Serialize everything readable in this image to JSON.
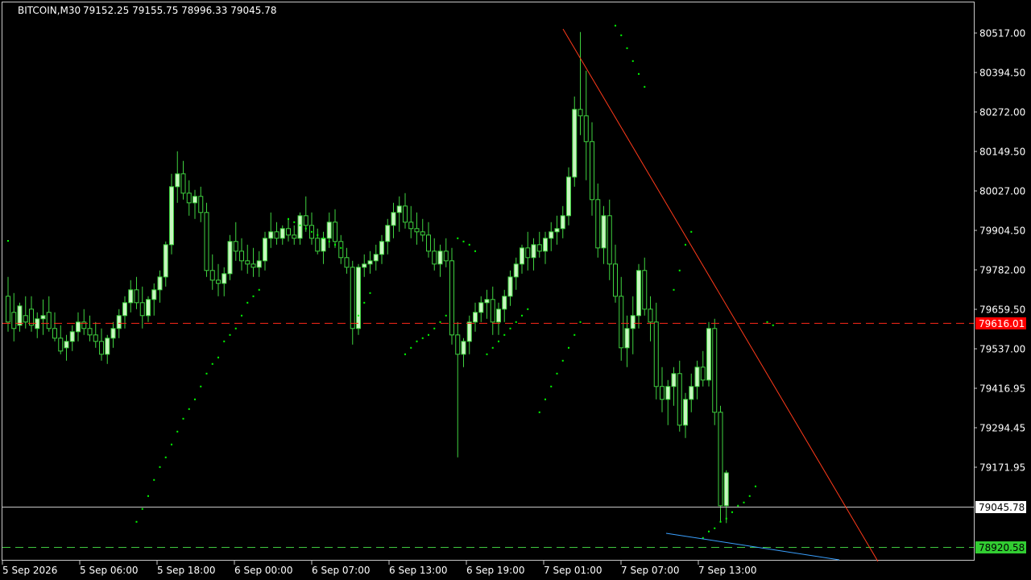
{
  "header": {
    "symbol": "BITCOIN,M30",
    "ohlc": "79152.25 79155.75 78996.33 79045.78"
  },
  "colors": {
    "background": "#000000",
    "frame": "#c8c8c8",
    "bull_candle": "#c8f5c0",
    "bear_candle": "#000000",
    "wick": "#3fd23f",
    "sar_dots": "#00ff00",
    "red_line": "#ff3a1a",
    "blue_line": "#3aa0ff",
    "red_label_bg": "#ff0000",
    "green_label_bg": "#32cd32"
  },
  "chart_data": {
    "type": "candlestick",
    "y_axis_ticks": [
      "80517.00",
      "80394.50",
      "80272.00",
      "80149.50",
      "80027.00",
      "79904.50",
      "79782.00",
      "79659.50",
      "79537.00",
      "79416.95",
      "79294.45",
      "79171.95"
    ],
    "y_range": [
      78880,
      80530
    ],
    "x_axis_ticks": [
      "5 Sep 2026",
      "5 Sep 06:00",
      "5 Sep 18:00",
      "6 Sep 00:00",
      "6 Sep 07:00",
      "6 Sep 13:00",
      "6 Sep 19:00",
      "7 Sep 01:00",
      "7 Sep 07:00",
      "7 Sep 13:00"
    ],
    "price_labels": {
      "current": "79045.78",
      "red_level": "79616.01",
      "green_level": "78920.58"
    },
    "levels": {
      "current": 79045.78,
      "red_level": 79616.01,
      "green_level": 78920.58
    },
    "candles": [
      [
        79700,
        79760,
        79590,
        79620
      ],
      [
        79650,
        79710,
        79560,
        79600
      ],
      [
        79610,
        79680,
        79590,
        79670
      ],
      [
        79640,
        79700,
        79600,
        79620
      ],
      [
        79660,
        79700,
        79590,
        79610
      ],
      [
        79600,
        79650,
        79570,
        79630
      ],
      [
        79630,
        79690,
        79580,
        79640
      ],
      [
        79650,
        79700,
        79590,
        79600
      ],
      [
        79600,
        79650,
        79560,
        79570
      ],
      [
        79570,
        79610,
        79520,
        79530
      ],
      [
        79540,
        79580,
        79500,
        79560
      ],
      [
        79560,
        79610,
        79530,
        79590
      ],
      [
        79590,
        79650,
        79560,
        79620
      ],
      [
        79620,
        79660,
        79580,
        79600
      ],
      [
        79600,
        79640,
        79560,
        79580
      ],
      [
        79580,
        79620,
        79540,
        79560
      ],
      [
        79560,
        79600,
        79500,
        79520
      ],
      [
        79520,
        79580,
        79490,
        79570
      ],
      [
        79570,
        79620,
        79540,
        79600
      ],
      [
        79600,
        79660,
        79570,
        79640
      ],
      [
        79640,
        79700,
        79600,
        79680
      ],
      [
        79680,
        79750,
        79650,
        79720
      ],
      [
        79720,
        79760,
        79660,
        79680
      ],
      [
        79680,
        79730,
        79600,
        79640
      ],
      [
        79640,
        79700,
        79620,
        79690
      ],
      [
        79690,
        79740,
        79640,
        79720
      ],
      [
        79720,
        79780,
        79680,
        79760
      ],
      [
        79760,
        79870,
        79730,
        79860
      ],
      [
        79860,
        80080,
        79830,
        80040
      ],
      [
        80040,
        80150,
        79990,
        80080
      ],
      [
        80080,
        80120,
        80000,
        80020
      ],
      [
        80020,
        80060,
        79950,
        79990
      ],
      [
        79990,
        80030,
        79940,
        80010
      ],
      [
        80010,
        80040,
        79930,
        79960
      ],
      [
        79960,
        79990,
        79760,
        79780
      ],
      [
        79780,
        79830,
        79720,
        79750
      ],
      [
        79750,
        79800,
        79700,
        79740
      ],
      [
        79740,
        79790,
        79700,
        79770
      ],
      [
        79770,
        79890,
        79750,
        79870
      ],
      [
        79870,
        79930,
        79810,
        79840
      ],
      [
        79840,
        79880,
        79780,
        79810
      ],
      [
        79810,
        79860,
        79770,
        79800
      ],
      [
        79800,
        79850,
        79760,
        79790
      ],
      [
        79790,
        79840,
        79760,
        79810
      ],
      [
        79810,
        79900,
        79780,
        79880
      ],
      [
        79880,
        79960,
        79850,
        79900
      ],
      [
        79900,
        79930,
        79860,
        79880
      ],
      [
        79880,
        79920,
        79860,
        79910
      ],
      [
        79910,
        79940,
        79870,
        79890
      ],
      [
        79890,
        79920,
        79860,
        79880
      ],
      [
        79880,
        79960,
        79860,
        79950
      ],
      [
        79950,
        80010,
        79900,
        79920
      ],
      [
        79920,
        79960,
        79860,
        79880
      ],
      [
        79880,
        79910,
        79830,
        79840
      ],
      [
        79840,
        79900,
        79800,
        79880
      ],
      [
        79880,
        79960,
        79850,
        79930
      ],
      [
        79930,
        79970,
        79850,
        79870
      ],
      [
        79870,
        79890,
        79800,
        79820
      ],
      [
        79820,
        79850,
        79770,
        79790
      ],
      [
        79790,
        79810,
        79550,
        79600
      ],
      [
        79600,
        79800,
        79580,
        79790
      ],
      [
        79790,
        79830,
        79760,
        79800
      ],
      [
        79800,
        79840,
        79770,
        79810
      ],
      [
        79810,
        79860,
        79780,
        79830
      ],
      [
        79830,
        79890,
        79800,
        79870
      ],
      [
        79870,
        79940,
        79830,
        79920
      ],
      [
        79920,
        79990,
        79880,
        79960
      ],
      [
        79960,
        80010,
        79900,
        79980
      ],
      [
        79980,
        80020,
        79910,
        79930
      ],
      [
        79930,
        79980,
        79880,
        79910
      ],
      [
        79910,
        79960,
        79860,
        79900
      ],
      [
        79900,
        79940,
        79870,
        79890
      ],
      [
        79890,
        79930,
        79820,
        79840
      ],
      [
        79840,
        79880,
        79780,
        79800
      ],
      [
        79800,
        79860,
        79760,
        79840
      ],
      [
        79840,
        79880,
        79790,
        79810
      ],
      [
        79810,
        79850,
        79550,
        79580
      ],
      [
        79580,
        79620,
        79200,
        79520
      ],
      [
        79520,
        79570,
        79480,
        79560
      ],
      [
        79560,
        79640,
        79520,
        79620
      ],
      [
        79620,
        79680,
        79590,
        79650
      ],
      [
        79650,
        79700,
        79620,
        79680
      ],
      [
        79680,
        79720,
        79630,
        79690
      ],
      [
        79690,
        79730,
        79580,
        79620
      ],
      [
        79620,
        79680,
        79580,
        79660
      ],
      [
        79660,
        79720,
        79620,
        79700
      ],
      [
        79700,
        79780,
        79670,
        79760
      ],
      [
        79760,
        79820,
        79720,
        79800
      ],
      [
        79800,
        79860,
        79770,
        79850
      ],
      [
        79850,
        79900,
        79780,
        79820
      ],
      [
        79820,
        79880,
        79780,
        79860
      ],
      [
        79860,
        79900,
        79820,
        79840
      ],
      [
        79840,
        79900,
        79800,
        79880
      ],
      [
        79880,
        79930,
        79840,
        79900
      ],
      [
        79900,
        79950,
        79860,
        79910
      ],
      [
        79910,
        79980,
        79880,
        79950
      ],
      [
        79950,
        80100,
        79920,
        80070
      ],
      [
        80070,
        80320,
        80040,
        80280
      ],
      [
        80280,
        80520,
        80200,
        80260
      ],
      [
        80260,
        80400,
        80060,
        80180
      ],
      [
        80180,
        80240,
        79950,
        80000
      ],
      [
        80000,
        80050,
        79820,
        79850
      ],
      [
        79850,
        79980,
        79800,
        79950
      ],
      [
        79950,
        80000,
        79750,
        79800
      ],
      [
        79800,
        79860,
        79680,
        79700
      ],
      [
        79700,
        79760,
        79500,
        79540
      ],
      [
        79540,
        79640,
        79480,
        79600
      ],
      [
        79600,
        79700,
        79520,
        79640
      ],
      [
        79640,
        79800,
        79600,
        79780
      ],
      [
        79780,
        79820,
        79640,
        79660
      ],
      [
        79660,
        79700,
        79560,
        79620
      ],
      [
        79620,
        79680,
        79380,
        79420
      ],
      [
        79420,
        79480,
        79340,
        79380
      ],
      [
        79380,
        79440,
        79300,
        79420
      ],
      [
        79420,
        79480,
        79360,
        79460
      ],
      [
        79460,
        79500,
        79280,
        79300
      ],
      [
        79300,
        79400,
        79260,
        79380
      ],
      [
        79380,
        79460,
        79340,
        79420
      ],
      [
        79420,
        79500,
        79380,
        79480
      ],
      [
        79480,
        79530,
        79420,
        79440
      ],
      [
        79440,
        79620,
        79420,
        79600
      ],
      [
        79600,
        79630,
        79300,
        79340
      ],
      [
        79340,
        79360,
        79000,
        79050
      ],
      [
        79050,
        79160,
        78996,
        79152
      ]
    ],
    "sar_segments": [
      [
        [
          0,
          79872
        ]
      ],
      [
        [
          22,
          79000
        ],
        [
          23,
          79040
        ],
        [
          24,
          79080
        ],
        [
          25,
          79130
        ],
        [
          26,
          79170
        ],
        [
          27,
          79200
        ],
        [
          28,
          79240
        ],
        [
          29,
          79280
        ],
        [
          30,
          79320
        ],
        [
          31,
          79350
        ],
        [
          32,
          79380
        ],
        [
          33,
          79420
        ],
        [
          34,
          79460
        ],
        [
          35,
          79490
        ],
        [
          36,
          79510
        ]
      ],
      [
        [
          37,
          79560
        ],
        [
          38,
          79580
        ],
        [
          39,
          79600
        ],
        [
          40,
          79640
        ],
        [
          41,
          79680
        ],
        [
          42,
          79700
        ],
        [
          43,
          79720
        ]
      ],
      [
        [
          48,
          79940
        ],
        [
          49,
          79930
        ],
        [
          50,
          79920
        ],
        [
          51,
          79910
        ],
        [
          52,
          79900
        ],
        [
          53,
          79890
        ],
        [
          54,
          79880
        ],
        [
          55,
          79870
        ],
        [
          56,
          79860
        ],
        [
          57,
          79850
        ]
      ],
      [
        [
          60,
          79640
        ],
        [
          61,
          79680
        ],
        [
          62,
          79710
        ]
      ],
      [
        [
          68,
          79520
        ],
        [
          69,
          79540
        ],
        [
          70,
          79560
        ],
        [
          71,
          79570
        ],
        [
          72,
          79580
        ],
        [
          73,
          79600
        ],
        [
          74,
          79620
        ],
        [
          75,
          79640
        ]
      ],
      [
        [
          77,
          79880
        ],
        [
          78,
          79870
        ],
        [
          79,
          79860
        ],
        [
          80,
          79840
        ]
      ],
      [
        [
          82,
          79520
        ],
        [
          83,
          79540
        ],
        [
          84,
          79560
        ],
        [
          85,
          79580
        ],
        [
          86,
          79600
        ],
        [
          87,
          79620
        ],
        [
          88,
          79640
        ],
        [
          89,
          79660
        ]
      ],
      [
        [
          91,
          79340
        ],
        [
          92,
          79380
        ],
        [
          93,
          79420
        ],
        [
          94,
          79460
        ],
        [
          95,
          79500
        ],
        [
          96,
          79540
        ],
        [
          97,
          79580
        ],
        [
          98,
          79620
        ]
      ],
      [
        [
          104,
          80540
        ],
        [
          105,
          80510
        ],
        [
          106,
          80470
        ],
        [
          107,
          80430
        ],
        [
          108,
          80390
        ],
        [
          109,
          80350
        ]
      ],
      [
        [
          114,
          79720
        ],
        [
          115,
          79780
        ],
        [
          116,
          79860
        ],
        [
          117,
          79900
        ]
      ],
      [
        [
          119,
          78950
        ],
        [
          120,
          78970
        ],
        [
          121,
          78980
        ],
        [
          122,
          79000
        ],
        [
          123,
          79010
        ],
        [
          124,
          79030
        ],
        [
          125,
          79050
        ],
        [
          126,
          79060
        ],
        [
          127,
          79080
        ],
        [
          128,
          79110
        ]
      ],
      [
        [
          130,
          79620
        ],
        [
          131,
          79610
        ]
      ]
    ]
  }
}
